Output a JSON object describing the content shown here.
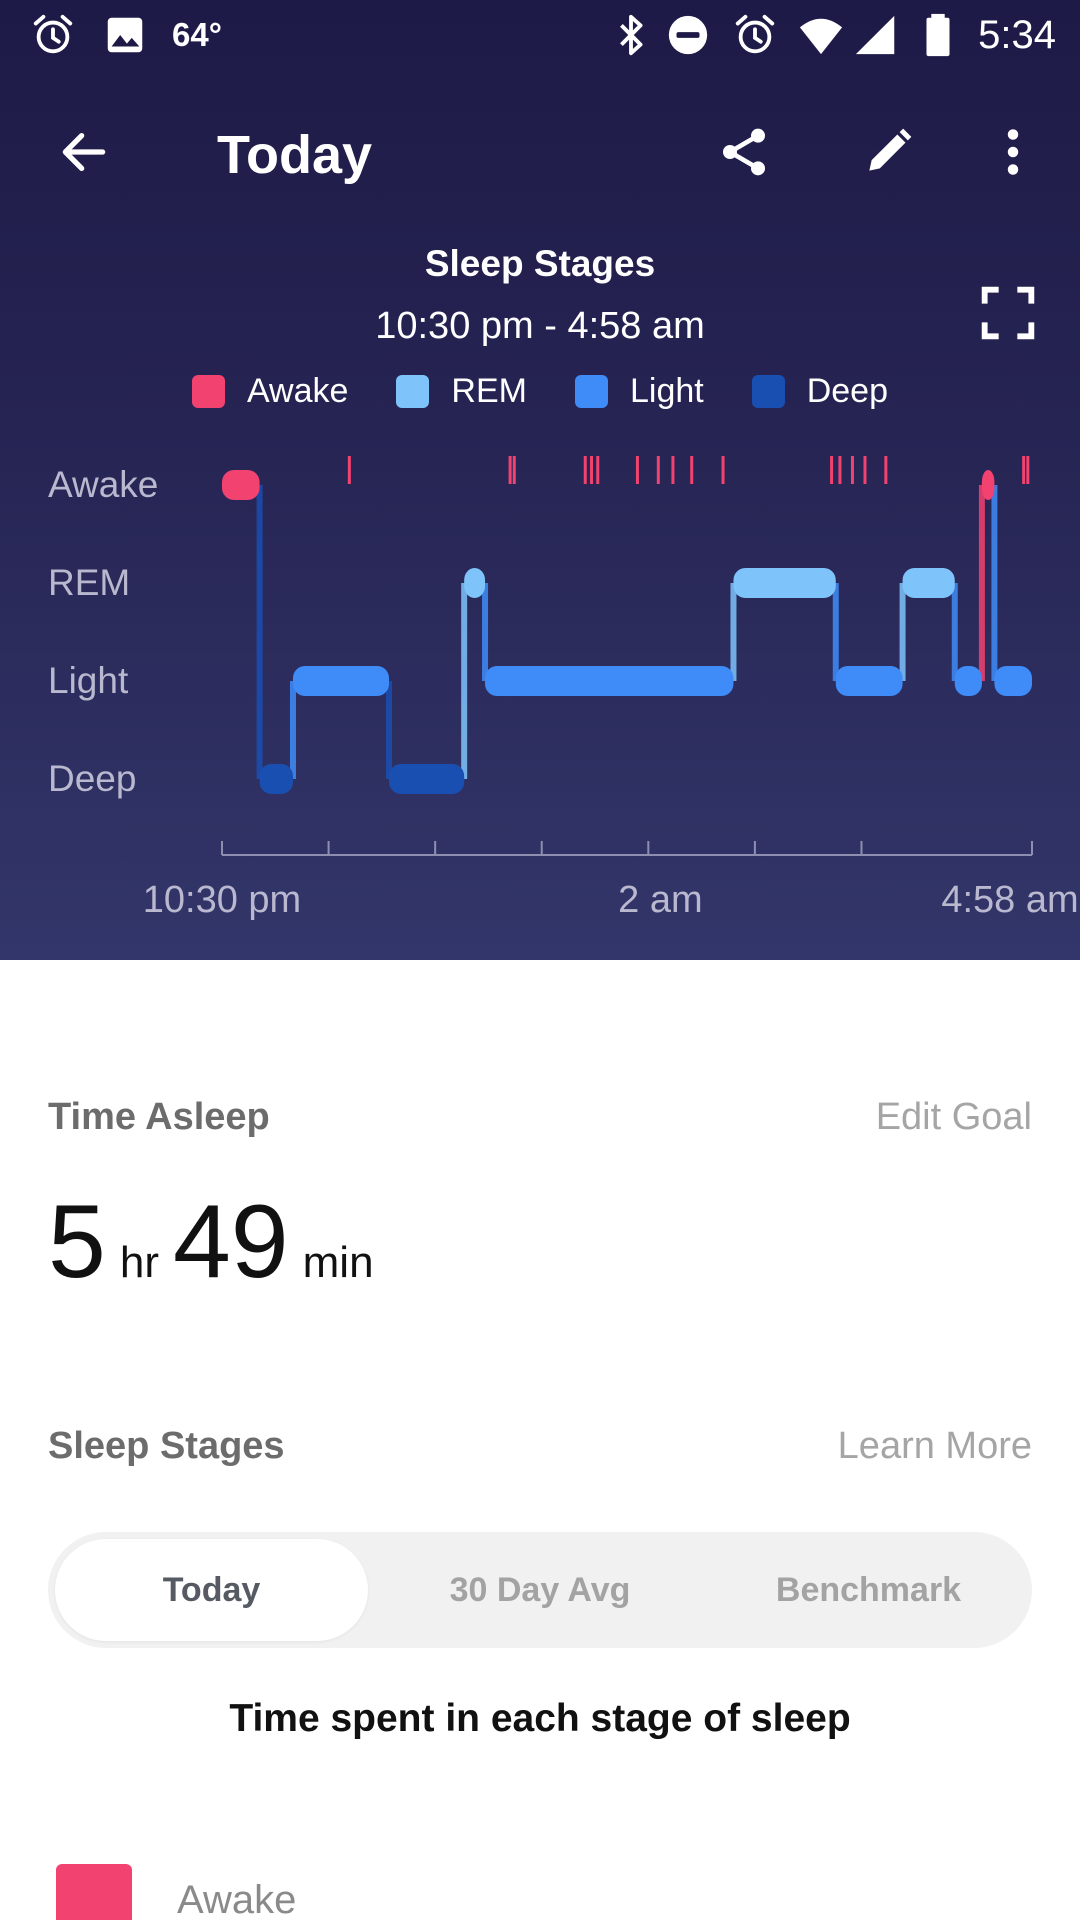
{
  "status_bar": {
    "temperature": "64°",
    "time": "5:34",
    "left_icons": [
      "alarm-icon",
      "image-icon"
    ],
    "right_icons": [
      "bluetooth-icon",
      "do-not-disturb-icon",
      "alarm-icon",
      "wifi-icon",
      "cell-signal-icon",
      "battery-icon"
    ]
  },
  "app_bar": {
    "title": "Today",
    "icons": [
      "back-arrow-icon",
      "share-icon",
      "edit-pencil-icon",
      "more-vert-icon"
    ]
  },
  "chart_header": {
    "title": "Sleep Stages",
    "range": "10:30 pm - 4:58 am",
    "expand_icon": "fullscreen-icon"
  },
  "colors": {
    "awake": "#f2426f",
    "rem": "#7ec4fb",
    "light": "#3f8cf8",
    "deep": "#1a4fb2",
    "hero_bg": "#262453",
    "label_muted": "#b9b8cf",
    "axis": "#8e8fb0"
  },
  "chart_data": {
    "type": "step-line",
    "title": "Sleep Stages",
    "legend": [
      {
        "label": "Awake",
        "color": "#f2426f"
      },
      {
        "label": "REM",
        "color": "#7ec4fb"
      },
      {
        "label": "Light",
        "color": "#3f8cf8"
      },
      {
        "label": "Deep",
        "color": "#1a4fb2"
      }
    ],
    "y_categories": [
      "Awake",
      "REM",
      "Light",
      "Deep"
    ],
    "x_tick_labels": [
      "10:30 pm",
      "2 am",
      "4:58 am"
    ],
    "x_range_minutes": [
      0,
      388
    ],
    "segments": [
      {
        "stage": "Awake",
        "start_min": 0,
        "end_min": 18
      },
      {
        "stage": "Deep",
        "start_min": 18,
        "end_min": 34
      },
      {
        "stage": "Light",
        "start_min": 34,
        "end_min": 80
      },
      {
        "stage": "Deep",
        "start_min": 80,
        "end_min": 116
      },
      {
        "stage": "REM",
        "start_min": 116,
        "end_min": 126
      },
      {
        "stage": "Light",
        "start_min": 126,
        "end_min": 245
      },
      {
        "stage": "REM",
        "start_min": 245,
        "end_min": 294
      },
      {
        "stage": "Light",
        "start_min": 294,
        "end_min": 326
      },
      {
        "stage": "REM",
        "start_min": 326,
        "end_min": 351
      },
      {
        "stage": "Light",
        "start_min": 351,
        "end_min": 364
      },
      {
        "stage": "Awake",
        "start_min": 364,
        "end_min": 370
      },
      {
        "stage": "Light",
        "start_min": 370,
        "end_min": 388
      }
    ],
    "brief_awakenings_min": [
      61,
      138,
      140,
      174,
      177,
      180,
      199,
      209,
      216,
      225,
      240,
      292,
      296,
      302,
      308,
      318,
      384,
      386
    ]
  },
  "time_asleep": {
    "heading": "Time Asleep",
    "link": "Edit Goal",
    "hours": "5",
    "hours_unit": "hr",
    "minutes": "49",
    "minutes_unit": "min"
  },
  "sleep_stages": {
    "heading": "Sleep Stages",
    "link": "Learn More",
    "tabs": [
      "Today",
      "30 Day Avg",
      "Benchmark"
    ],
    "active_tab": "Today",
    "caption": "Time spent in each stage of sleep",
    "stage_list": [
      {
        "label": "Awake",
        "color": "#f2426f"
      }
    ]
  }
}
